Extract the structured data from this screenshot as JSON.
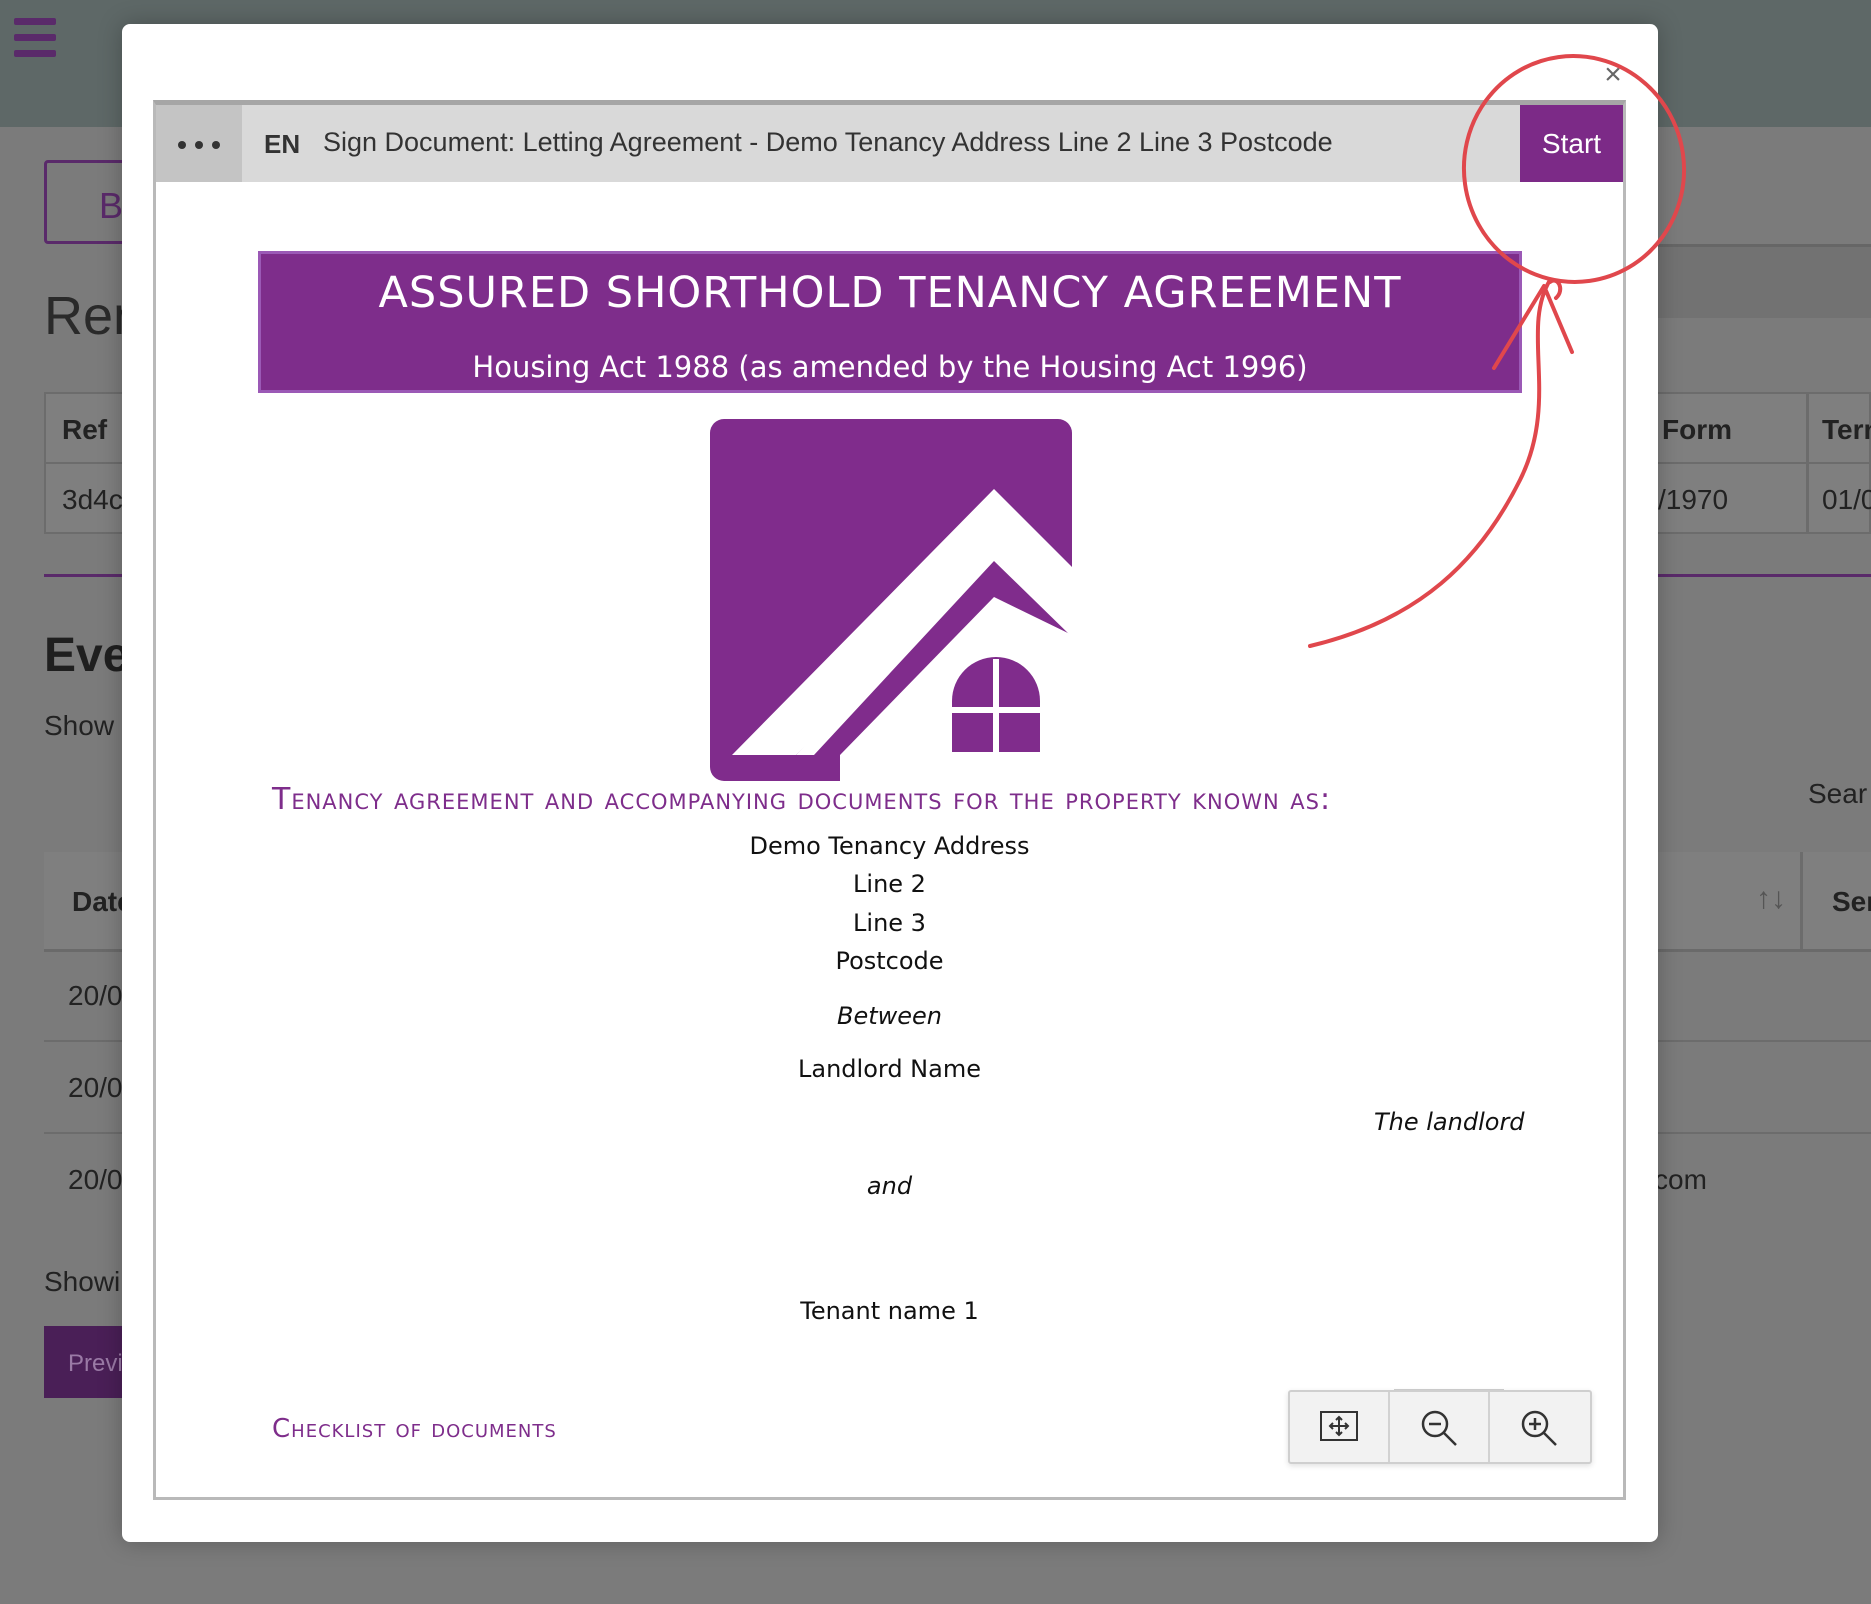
{
  "background": {
    "back_button_fragment": "B",
    "page_title_fragment": "Ren",
    "table": {
      "headers": {
        "ref": "Ref",
        "form": "Form",
        "term": "Tern"
      },
      "row": {
        "ref": "3d4c",
        "form_date": "/1970",
        "term_date": "01/0"
      }
    },
    "events_heading_fragment": "Eve",
    "show_fragment": "Show",
    "search_fragment": "Sear",
    "events_table": {
      "headers": {
        "date": "Date",
        "sent": "Ser"
      },
      "sort_icon": "sort-arrows-icon",
      "rows": [
        {
          "date": "20/0",
          "right": ""
        },
        {
          "date": "20/0",
          "right": ""
        },
        {
          "date": "20/0",
          "right": "com"
        }
      ]
    },
    "showing_fragment": "Showi",
    "previous_fragment": "Previ",
    "colors": {
      "brand": "#5a2a6a",
      "header": "#5e6867"
    }
  },
  "modal": {
    "close_icon": "close-icon",
    "close_glyph": "×",
    "viewer": {
      "more_icon": "more-dots-icon",
      "language": "EN",
      "title": "Sign Document: Letting Agreement - Demo Tenancy Address Line 2 Line 3 Postcode",
      "start_label": "Start",
      "accent": "#7c2a87"
    },
    "document": {
      "banner_title": "ASSURED SHORTHOLD TENANCY AGREEMENT",
      "banner_subtitle": "Housing Act 1988 (as amended by the Housing Act 1996)",
      "logo": "house-logo",
      "property_heading": "Tenancy agreement and accompanying documents for the property known as:",
      "address_lines": [
        "Demo Tenancy Address",
        "Line 2",
        "Line 3",
        "Postcode"
      ],
      "between": "Between",
      "landlord_name": "Landlord Name",
      "landlord_role": "The landlord",
      "and": "and",
      "tenant_name": "Tenant name 1",
      "checklist_heading": "Checklist of documents"
    },
    "zoom_controls": [
      "fit-page-icon",
      "zoom-out-icon",
      "zoom-in-icon"
    ]
  },
  "annotation": {
    "shape": "circle-with-arrow",
    "color": "#e0474c"
  }
}
